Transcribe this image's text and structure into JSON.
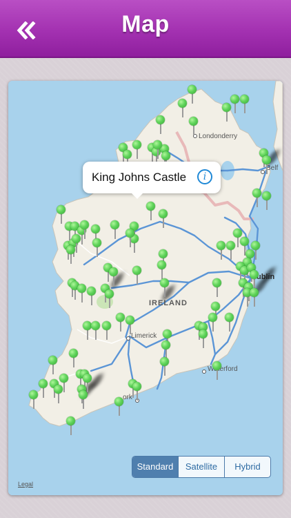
{
  "header": {
    "title": "Map",
    "back_icon": "double-chevron-left-icon",
    "color": "#a331b1"
  },
  "map": {
    "callout": {
      "title": "King Johns Castle",
      "info_icon": "info-icon"
    },
    "labels": {
      "londonderry": "Londonderry",
      "belfast": "Belf",
      "dublin": "ublin",
      "ireland": "IRELAND",
      "limerick": "Limerick",
      "waterford": "Waterford",
      "cork": "ork"
    },
    "water_color": "#a8d2ec",
    "land_color": "#f2efe6",
    "pin_color": "#5fd35a",
    "pin_count": 95
  },
  "map_type": {
    "options": [
      "Standard",
      "Satellite",
      "Hybrid"
    ],
    "selected": "Standard"
  },
  "legal": "Legal"
}
